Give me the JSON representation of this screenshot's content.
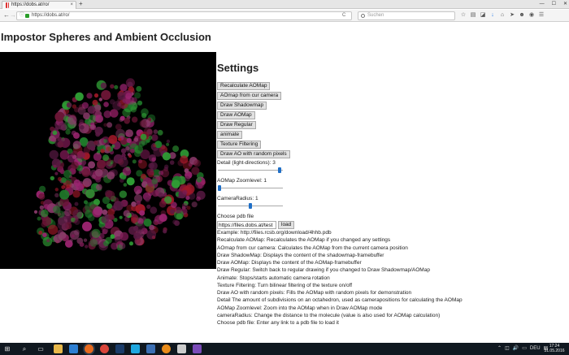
{
  "browser": {
    "tab_title": "https://dobs.at/ro/",
    "tab_close": "×",
    "new_tab": "+",
    "window_controls": [
      "—",
      "☐",
      "✕"
    ],
    "url_info": "ⓘ",
    "url": "https://dobs.at/ro/",
    "search_placeholder": "Suchen",
    "back": "←",
    "forward": "→",
    "reload": "C",
    "toolbar_icons": [
      "star-icon",
      "reading-list-icon",
      "pocket-icon",
      "download-icon",
      "home-icon",
      "send-icon",
      "smiley-icon",
      "screenshot-icon",
      "menu-icon"
    ],
    "toolbar_glyphs": [
      "☆",
      "▤",
      "◪",
      "↓",
      "⌂",
      "➤",
      "☻",
      "◉",
      "☰"
    ]
  },
  "page": {
    "title": "Impostor Spheres and Ambient Occlusion",
    "settings_title": "Settings",
    "buttons": {
      "recalculate": "Recalculate AOMap",
      "aomap_from_camera": "AOmap from cur camera",
      "draw_shadowmap": "Draw Shadowmap",
      "draw_aomap": "Draw AOMap",
      "draw_regular": "Draw Regular",
      "animate": "animate",
      "texture_filtering": "Texture Filtering",
      "draw_ao_random": "Draw AO with random pixels",
      "load": "load"
    },
    "detail_label": "Detail (light-directions): 3",
    "detail_value": 3,
    "detail_fraction": 0.97,
    "zoom_label": "AOMap Zoomlevel: 1",
    "zoom_value": 1,
    "zoom_fraction": 0.0,
    "camera_label": "CameraRadius: 1",
    "camera_value": 1,
    "camera_fraction": 0.5,
    "pdb_label": "Choose pdb file",
    "pdb_value": "https://files.dobs.at/test",
    "help_lines": [
      "Example: http://files.rcsb.org/download/4hhb.pdb",
      "Recalculate AOMap: Recalculates the AOMap if you changed any settings",
      "AOmap from cur camera: Calculates the AOMap from the current camera position",
      "Draw ShadowMap: Displays the content of the shadowmap-framebuffer",
      "Draw AOMap: Displays the content of the AOMap-framebuffer",
      "Draw Regular: Switch back to regular drawing if you changed to Draw Shadowmap/AOMap",
      "Animate: Stops/starts automatic camera rotation",
      "Texture Filtering: Turn bilinear filtering of the texture on/off",
      "Draw AO with random pixels: Fills the AOMap with random pixels for demonstration",
      "Detail The amount of subdivisions on an octahedron, used as camerapositions for calculating the AOMap",
      "AOMap Zoomlevel: Zoom into the AOMap when in Draw AOMap mode",
      "cameraRadius: Change the distance to the molecule (value is also used for AOMap calculation)",
      "Choose pdb file: Enter any link to a pdb file to load it"
    ],
    "molecule_colors": [
      "#7a1a52",
      "#9b2470",
      "#5a1a44",
      "#1f7a2a",
      "#2f9a34",
      "#a01828",
      "#6a1535",
      "#8a3a6a"
    ]
  },
  "taskbar": {
    "start": "⊞",
    "search": "⌕",
    "task_view": "▭",
    "apps": [
      "file-explorer-icon",
      "edge-icon",
      "firefox-icon",
      "chrome-icon",
      "steam-icon",
      "skype-icon",
      "media-icon",
      "blender-icon",
      "unity-icon",
      "visual-studio-icon"
    ],
    "app_colors": [
      "#e8b84a",
      "#2d7fd3",
      "#e76a1e",
      "#d9453b",
      "#1b3c6a",
      "#1ea7e0",
      "#3c6fb3",
      "#e88b1a",
      "#cccccc",
      "#7a4bb8"
    ],
    "tray": [
      "⌃",
      "◫",
      "🔊",
      "▭",
      "DEU",
      "▤"
    ],
    "time": "17:24",
    "date": "31.05.2016"
  }
}
